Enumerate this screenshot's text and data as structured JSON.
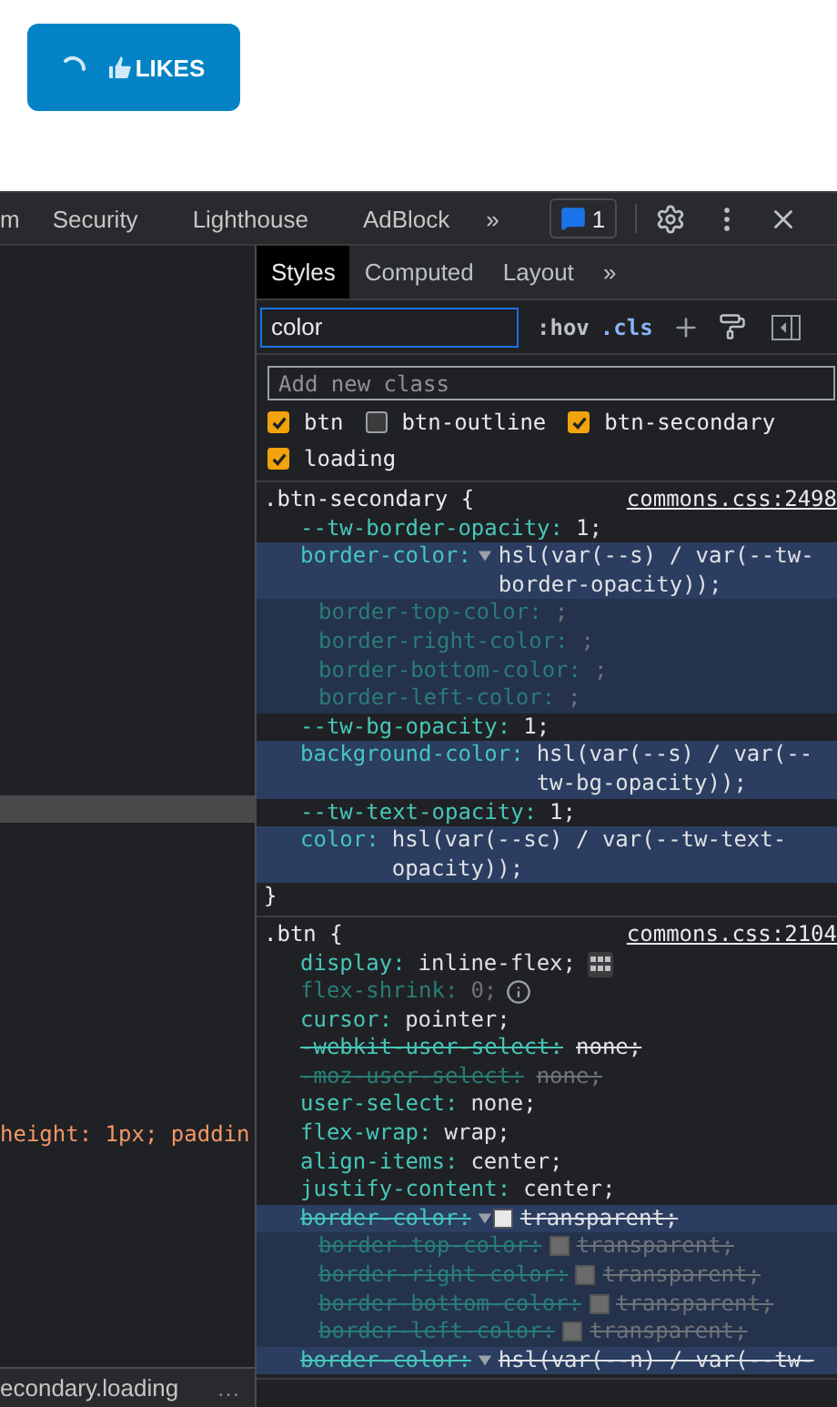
{
  "page": {
    "button": {
      "label": "LIKES",
      "loading": true
    }
  },
  "toolbar": {
    "tabs": [
      {
        "label": "m"
      },
      {
        "label": "Security"
      },
      {
        "label": "Lighthouse"
      },
      {
        "label": "AdBlock"
      }
    ],
    "overflow": "»",
    "issues_count": "1"
  },
  "elements_panel": {
    "code_line": "height: 1px; paddin",
    "breadcrumb": "econdary.loading",
    "breadcrumb_more": "…"
  },
  "styles_pane": {
    "tabs": [
      {
        "label": "Styles",
        "selected": true
      },
      {
        "label": "Computed",
        "selected": false
      },
      {
        "label": "Layout",
        "selected": false
      }
    ],
    "tabs_overflow": "»",
    "filter": {
      "value": "color"
    },
    "hov": ":hov",
    "cls": ".cls",
    "new_class": {
      "placeholder": "Add new class"
    },
    "classes": [
      {
        "name": "btn",
        "checked": true
      },
      {
        "name": "btn-outline",
        "checked": false
      },
      {
        "name": "btn-secondary",
        "checked": true
      },
      {
        "name": "loading",
        "checked": true
      }
    ],
    "rules": [
      {
        "selector": ".btn-secondary {",
        "source": "commons.css:2498",
        "close": "}",
        "declarations": [
          {
            "kind": "plain",
            "name": "--tw-border-opacity:",
            "value": "1;",
            "highlighted": false,
            "struck": false,
            "inactive": false
          },
          {
            "kind": "plain",
            "name": "border-color:",
            "value": "hsl(var(--s) / var(--tw-border-opacity));",
            "highlighted": true,
            "struck": false,
            "inactive": false,
            "expanded": true,
            "children": [
              {
                "name": "border-top-color:",
                "value": ";",
                "highlighted": true,
                "struck": false,
                "inactive": true
              },
              {
                "name": "border-right-color:",
                "value": ";",
                "highlighted": true,
                "struck": false,
                "inactive": true
              },
              {
                "name": "border-bottom-color:",
                "value": ";",
                "highlighted": true,
                "struck": false,
                "inactive": true
              },
              {
                "name": "border-left-color:",
                "value": ";",
                "highlighted": true,
                "struck": false,
                "inactive": true
              }
            ]
          },
          {
            "kind": "plain",
            "name": "--tw-bg-opacity:",
            "value": "1;",
            "highlighted": false,
            "struck": false,
            "inactive": false
          },
          {
            "kind": "plain",
            "name": "background-color:",
            "value": "hsl(var(--s) / var(--tw-bg-opacity));",
            "highlighted": true,
            "struck": false,
            "inactive": false
          },
          {
            "kind": "plain",
            "name": "--tw-text-opacity:",
            "value": "1;",
            "highlighted": false,
            "struck": false,
            "inactive": false
          },
          {
            "kind": "plain",
            "name": "color:",
            "value": "hsl(var(--sc) / var(--tw-text-opacity));",
            "highlighted": true,
            "struck": false,
            "inactive": false
          }
        ]
      },
      {
        "selector": ".btn {",
        "source": "commons.css:2104",
        "declarations": [
          {
            "kind": "flex_editor",
            "name": "display:",
            "value": "inline-flex;",
            "highlighted": false,
            "struck": false,
            "inactive": false
          },
          {
            "kind": "info",
            "name": "flex-shrink:",
            "value": "0;",
            "highlighted": false,
            "struck": false,
            "inactive": true
          },
          {
            "kind": "plain",
            "name": "cursor:",
            "value": "pointer;",
            "highlighted": false,
            "struck": false,
            "inactive": false
          },
          {
            "kind": "plain",
            "name": "-webkit-user-select:",
            "value": "none;",
            "highlighted": false,
            "struck": true,
            "inactive": false
          },
          {
            "kind": "plain",
            "name": "-moz-user-select:",
            "value": "none;",
            "highlighted": false,
            "struck": true,
            "inactive": true
          },
          {
            "kind": "plain",
            "name": "user-select:",
            "value": "none;",
            "highlighted": false,
            "struck": false,
            "inactive": false
          },
          {
            "kind": "plain",
            "name": "flex-wrap:",
            "value": "wrap;",
            "highlighted": false,
            "struck": false,
            "inactive": false
          },
          {
            "kind": "plain",
            "name": "align-items:",
            "value": "center;",
            "highlighted": false,
            "struck": false,
            "inactive": false
          },
          {
            "kind": "plain",
            "name": "justify-content:",
            "value": "center;",
            "highlighted": false,
            "struck": false,
            "inactive": false
          },
          {
            "kind": "plain",
            "name": "border-color:",
            "value": "transparent;",
            "highlighted": true,
            "struck": true,
            "inactive": false,
            "swatch": true,
            "expanded": true,
            "children": [
              {
                "name": "border-top-color:",
                "value": "transparent;",
                "highlighted": true,
                "struck": true,
                "inactive": true,
                "swatch": true
              },
              {
                "name": "border-right-color:",
                "value": "transparent;",
                "highlighted": true,
                "struck": true,
                "inactive": true,
                "swatch": true
              },
              {
                "name": "border-bottom-color:",
                "value": "transparent;",
                "highlighted": true,
                "struck": true,
                "inactive": true,
                "swatch": true
              },
              {
                "name": "border-left-color:",
                "value": "transparent;",
                "highlighted": true,
                "struck": true,
                "inactive": true,
                "swatch": true
              }
            ]
          },
          {
            "kind": "plain",
            "name": "border-color:",
            "value": "hsl(var(--n) / var(--tw-",
            "highlighted": true,
            "struck": true,
            "inactive": false,
            "expanded": true
          }
        ]
      }
    ]
  }
}
